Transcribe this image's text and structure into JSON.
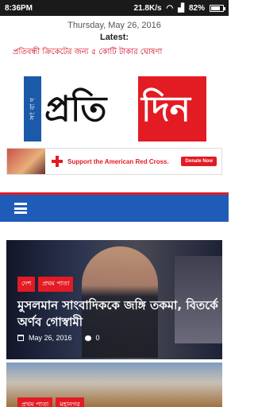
{
  "status": {
    "time": "8:36PM",
    "speed": "21.8K/s",
    "battery": "82%",
    "battery_level": 0.82
  },
  "header": {
    "date": "Thursday, May 26, 2016",
    "latest_label": "Latest:",
    "ticker": "প্রতিবন্ধী ক্রিকেটের জন্য ৫ কোটি টাকার ঘোষণা"
  },
  "logo": {
    "side_text": "সং বা দ",
    "part1": "প্রতি",
    "part2": "দিন"
  },
  "ad": {
    "text": "Support the American Red Cross.",
    "button": "Donate Now"
  },
  "nav": {
    "menu_icon": "hamburger-icon"
  },
  "articles": [
    {
      "tags": [
        "দেশ",
        "প্রথম পাতা"
      ],
      "headline": "মুসলমান সাংবাদিককে জঙ্গি তকমা, বিতর্কে অর্ণব গোস্বামী",
      "date": "May 26, 2016",
      "comments": "0"
    },
    {
      "tags": [
        "প্রথম পাতা",
        "মহানগর"
      ]
    }
  ],
  "colors": {
    "accent": "#e31b23",
    "nav": "#1f5cb8",
    "ticker": "#d0021b"
  }
}
